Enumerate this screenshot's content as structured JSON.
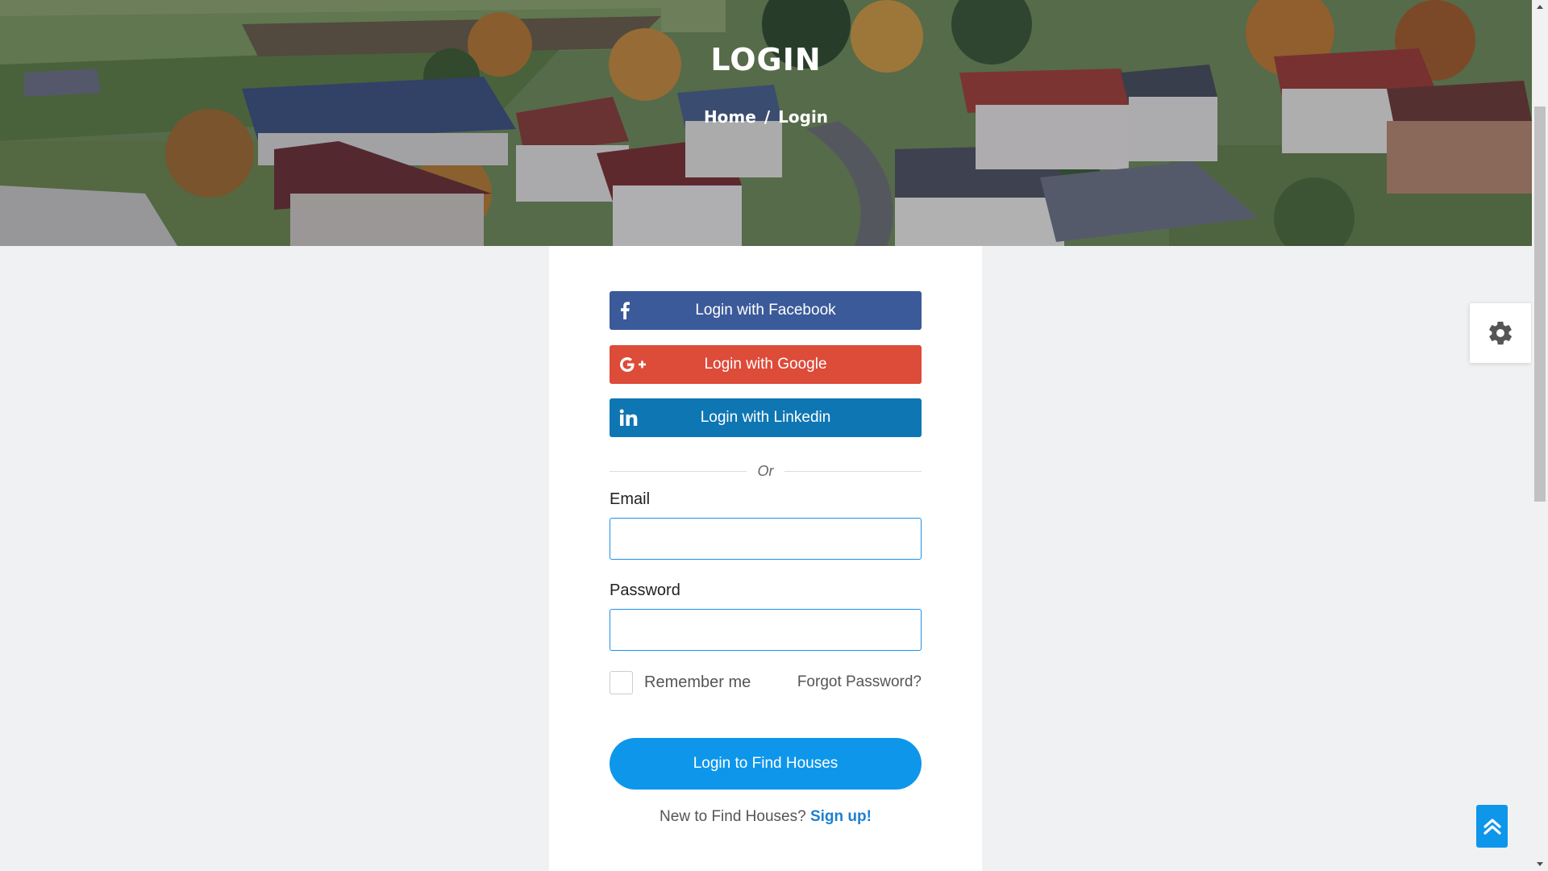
{
  "hero": {
    "title": "LOGIN",
    "breadcrumb": {
      "home": "Home",
      "separator": "/",
      "current": "Login"
    }
  },
  "social": {
    "facebook": {
      "label": "Login with Facebook",
      "icon": "facebook-icon",
      "color": "#3b5a9a"
    },
    "google": {
      "label": "Login with Google",
      "icon": "google-plus-icon",
      "color": "#dd4b39"
    },
    "linkedin": {
      "label": "Login with Linkedin",
      "icon": "linkedin-icon",
      "color": "#0e76b3"
    }
  },
  "divider_text": "Or",
  "form": {
    "email_label": "Email",
    "email_value": "",
    "password_label": "Password",
    "password_value": "",
    "remember_label": "Remember me",
    "remember_checked": false,
    "forgot_label": "Forgot Password?",
    "submit_label": "Login to Find Houses",
    "signup_prompt": "New to Find Houses?",
    "signup_link": "Sign up!"
  },
  "widgets": {
    "settings_icon": "gear-icon",
    "back_to_top_icon": "double-chevron-up-icon",
    "accent_color": "#0e96eb"
  }
}
